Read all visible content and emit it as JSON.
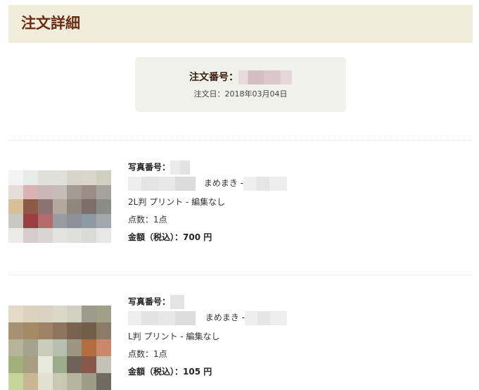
{
  "page": {
    "title": "注文詳細"
  },
  "order": {
    "number_label": "注文番号：",
    "date": "注文日：2018年03月04日"
  },
  "items": [
    {
      "photo_no_label": "写真番号：",
      "name_suffix": "まめまき -",
      "product": "2L判 プリント - 編集なし",
      "quantity": "点数：1点",
      "price": "金額（税込）：700 円"
    },
    {
      "photo_no_label": "写真番号：",
      "name_suffix": "まめまき -",
      "product": "L判 プリント - 編集なし",
      "quantity": "点数：1点",
      "price": "金額（税込）：105 円"
    }
  ],
  "colors": {
    "header_bg": "#f1ecdc",
    "title_text": "#6a2c13",
    "order_box_bg": "#f1f1ec"
  },
  "thumbnails": [
    {
      "cols": 7,
      "cells": [
        "#f3f4f3",
        "#e9ebe8",
        "#e0e0da",
        "#dfe0da",
        "#d9d4c7",
        "#d8d6cb",
        "#cfd0c0",
        "#e4dcd8",
        "#d9b2b4",
        "#c9b7b6",
        "#c6bdb7",
        "#a49a94",
        "#9c8c88",
        "#a4a39d",
        "#d8bf96",
        "#8e5a48",
        "#8c7372",
        "#b2a99c",
        "#8f877d",
        "#7d6e6c",
        "#8a8c88",
        "#c7c9c2",
        "#9b3e41",
        "#b46b6e",
        "#9a9ba0",
        "#8f8f9a",
        "#8e9aa1",
        "#a3a8ad",
        "#ebeae6",
        "#d6cccb",
        "#dbd4d4",
        "#e3e3e0",
        "#dfdfdc",
        "#dadbd8",
        "#e6e7e6"
      ]
    },
    {
      "cols": 7,
      "cells": [
        "#e4dac8",
        "#dcd3bf",
        "#d9d2c2",
        "#dbd8c8",
        "#d2d0c0",
        "#9c9a8a",
        "#a19f88",
        "#a69174",
        "#a48b66",
        "#9e8464",
        "#8d7560",
        "#7a6250",
        "#735e4a",
        "#8a7c66",
        "#b5b49b",
        "#a3a38e",
        "#c9ccba",
        "#b8bfae",
        "#9c9580",
        "#b46d3f",
        "#c9886b",
        "#9fb07b",
        "#a79f80",
        "#e8e9dd",
        "#9bad8c",
        "#6e6259",
        "#88584a",
        "#c3c2b4",
        "#c4d69b",
        "#cbb694",
        "#e2e1d1",
        "#c9c8b3",
        "#b8b59e",
        "#9d9c86",
        "#6f6b5e"
      ]
    }
  ]
}
